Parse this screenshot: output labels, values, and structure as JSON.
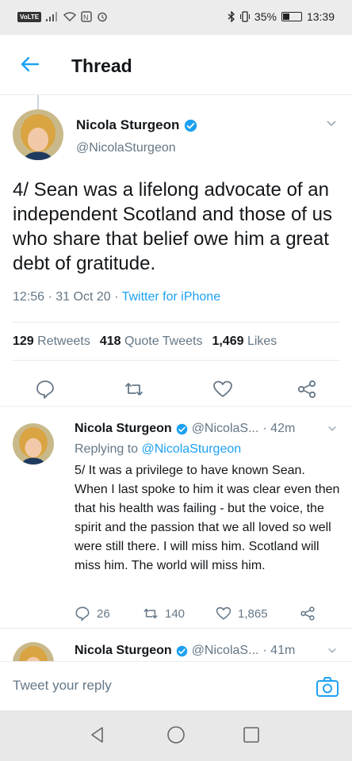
{
  "status_bar": {
    "carrier_badge": "VoLTE",
    "battery_percent": "35%",
    "battery_level": 0.35,
    "time": "13:39"
  },
  "header": {
    "title": "Thread"
  },
  "main_tweet": {
    "author_name": "Nicola Sturgeon",
    "author_handle": "@NicolaSturgeon",
    "text": "4/ Sean was a lifelong advocate of an independent Scotland and those of us who share that belief owe him a great debt of gratitude.",
    "time": "12:56",
    "date": "31 Oct 20",
    "source": "Twitter for iPhone",
    "retweets_count": "129",
    "retweets_label": "Retweets",
    "quotes_count": "418",
    "quotes_label": "Quote Tweets",
    "likes_count": "1,469",
    "likes_label": "Likes"
  },
  "reply_tweet": {
    "author_name": "Nicola Sturgeon",
    "author_handle": "@NicolaS...",
    "age": "· 42m",
    "replying_prefix": "Replying to",
    "replying_to": "@NicolaSturgeon",
    "text": "5/ It was a privilege to have known Sean. When I last spoke to him it was clear even then that his health was failing - but the voice, the spirit and the passion that we all loved so well were still there. I will miss him. Scotland will miss him. The world will miss him.",
    "replies": "26",
    "retweets": "140",
    "likes": "1,865"
  },
  "next_tweet": {
    "author_name": "Nicola Sturgeon",
    "author_handle": "@NicolaS...",
    "age": "· 41m"
  },
  "composer": {
    "placeholder": "Tweet your reply"
  },
  "colors": {
    "accent": "#1da1f2",
    "text": "#14171a",
    "secondary": "#657786",
    "divider": "#e6ecf0"
  }
}
